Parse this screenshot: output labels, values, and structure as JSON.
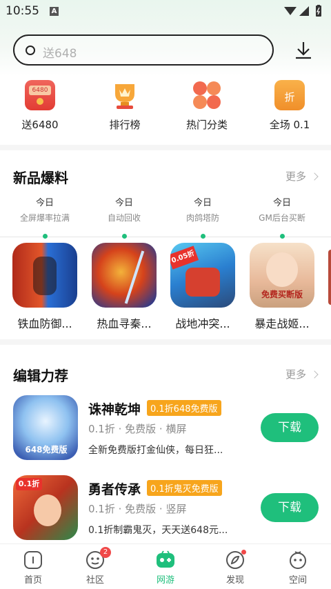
{
  "status_bar": {
    "time": "10:55",
    "notif_letter": "A"
  },
  "search": {
    "placeholder": "送648"
  },
  "quick_links": [
    {
      "label": "送6480",
      "icon": "red-envelope-icon",
      "badge": "6480"
    },
    {
      "label": "排行榜",
      "icon": "trophy-icon"
    },
    {
      "label": "热门分类",
      "icon": "category-grid-icon"
    },
    {
      "label": "全场 0.1",
      "icon": "discount-icon",
      "badge": "折"
    }
  ],
  "new_section": {
    "title": "新品爆料",
    "more": "更多",
    "timeline": [
      {
        "day": "今日",
        "desc": "全屏爆率拉满"
      },
      {
        "day": "今日",
        "desc": "自动回收"
      },
      {
        "day": "今日",
        "desc": "肉鸽塔防"
      },
      {
        "day": "今日",
        "desc": "GM后台买断"
      }
    ],
    "games": [
      {
        "name": "铁血防御..."
      },
      {
        "name": "热血寻秦..."
      },
      {
        "name": "战地冲突..."
      },
      {
        "name": "暴走战姬..."
      }
    ]
  },
  "editor_section": {
    "title": "编辑力荐",
    "more": "更多",
    "items": [
      {
        "name": "诛神乾坤",
        "tag": "0.1折648免费版",
        "meta": "0.1折 · 免费版 · 横屏",
        "desc": "全新免费版打金仙侠，每日狂...",
        "button": "下载",
        "icon_text": "648免费版"
      },
      {
        "name": "勇者传承",
        "tag": "0.1折鬼灭免费版",
        "meta": "0.1折 · 免费版 · 竖屏",
        "desc": "0.1折制霸鬼灭，天天送648元...",
        "button": "下载",
        "icon_text": "0.1折"
      }
    ]
  },
  "tabbar": [
    {
      "label": "首页",
      "icon": "home-icon"
    },
    {
      "label": "社区",
      "icon": "community-icon",
      "badge": "2"
    },
    {
      "label": "网游",
      "icon": "gamepad-icon",
      "active": true
    },
    {
      "label": "发现",
      "icon": "discover-icon"
    },
    {
      "label": "空间",
      "icon": "profile-icon"
    }
  ],
  "colors": {
    "accent": "#1fbf7c",
    "tag": "#f7a51c",
    "badge": "#f04848"
  }
}
